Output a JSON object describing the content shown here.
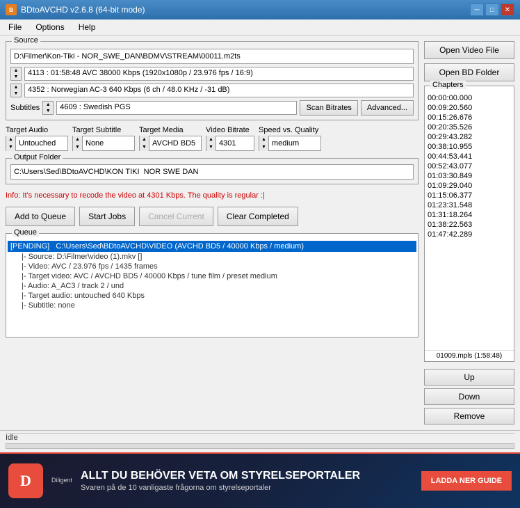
{
  "titleBar": {
    "icon": "BD",
    "title": "BDtoAVCHD v2.6.8  (64-bit mode)",
    "controls": [
      "minimize",
      "maximize",
      "close"
    ]
  },
  "menuBar": {
    "items": [
      "File",
      "Options",
      "Help"
    ]
  },
  "source": {
    "label": "Source",
    "path": "D:\\Filmer\\Kon-Tiki - NOR_SWE_DAN\\BDMV\\STREAM\\00011.m2ts",
    "video": "4113 :  01:58:48  AVC  38000 Kbps  (1920x1080p / 23.976 fps / 16:9)",
    "audio": "4352 :  Norwegian  AC-3  640 Kbps  (6 ch / 48.0 KHz / -31 dB)",
    "subtitlesId": "4609 :  Swedish  PGS",
    "subtitlesLabel": "Subtitles",
    "scanBitratesLabel": "Scan Bitrates",
    "advancedLabel": "Advanced..."
  },
  "targets": {
    "audio": {
      "label": "Target Audio",
      "value": "Untouched"
    },
    "subtitle": {
      "label": "Target Subtitle",
      "value": "None"
    },
    "media": {
      "label": "Target Media",
      "value": "AVCHD BD5"
    },
    "videoBitrate": {
      "label": "Video Bitrate",
      "value": "4301"
    },
    "speedQuality": {
      "label": "Speed vs. Quality",
      "value": "medium"
    }
  },
  "outputFolder": {
    "label": "Output Folder",
    "path": "C:\\Users\\Sed\\BDtoAVCHD\\KON TIKI  NOR SWE DAN"
  },
  "infoMessage": "Info: It's necessary to recode the video at 4301 Kbps. The quality is regular :|",
  "buttons": {
    "addToQueue": "Add to Queue",
    "startJobs": "Start Jobs",
    "cancelCurrent": "Cancel Current",
    "clearCompleted": "Clear Completed",
    "openVideoFile": "Open Video File",
    "openBDFolder": "Open BD Folder",
    "up": "Up",
    "down": "Down",
    "remove": "Remove"
  },
  "queue": {
    "label": "Queue",
    "items": [
      {
        "status": "[PENDING]",
        "path": "C:\\Users\\Sed\\BDtoAVCHD\\VIDEO (AVCHD BD5 / 40000 Kbps / medium)",
        "details": [
          "Source: D:\\Filmer\\video (1).mkv  []",
          "Video: AVC / 23.976 fps / 1435 frames",
          "Target video: AVC / AVCHD BD5 / 40000 Kbps / tune film / preset medium",
          "Audio: A_AC3 / track 2 / und",
          "Target audio: untouched 640 Kbps",
          "Subtitle: none"
        ]
      }
    ]
  },
  "chapters": {
    "label": "Chapters",
    "items": [
      "00:00:00.000",
      "00:09:20.560",
      "00:15:26.676",
      "00:20:35.526",
      "00:29:43.282",
      "00:38:10.955",
      "00:44:53.441",
      "00:52:43.077",
      "01:03:30.849",
      "01:09:29.040",
      "01:15:06.377",
      "01:23:31.548",
      "01:31:18.264",
      "01:38:22.563",
      "01:47:42.289"
    ],
    "footer": "01009.mpls (1:58:48)"
  },
  "statusBar": {
    "text": "Idle"
  },
  "ad": {
    "headline": "ALLT DU BEHÖVER VETA OM STYRELSEPORTALER",
    "subtext": "Svaren på de 10 vanligaste frågorna om styrelseportaler",
    "cta": "LADDA NER GUIDE",
    "logoLetter": "D",
    "logoSubtext": "Diligent"
  }
}
